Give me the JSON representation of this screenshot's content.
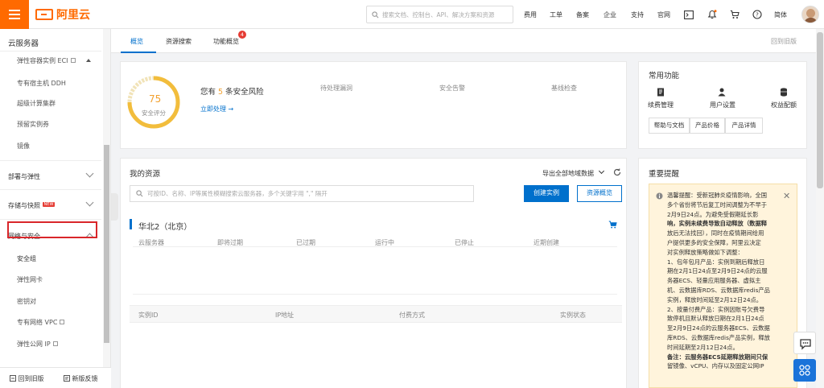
{
  "brand": {
    "logo_text": "阿里云",
    "accent": "#ff6a00",
    "primary": "#0070cc"
  },
  "topbar": {
    "search_placeholder": "搜索文档、控制台、API、解决方案和资源",
    "links": [
      "费用",
      "工单",
      "备案",
      "企业",
      "支持",
      "官网"
    ],
    "language": "简体",
    "icons": [
      "terminal-icon",
      "bell-icon",
      "cart-icon",
      "help-icon"
    ]
  },
  "sidebar": {
    "title": "云服务器",
    "top_items": [
      "弹性容器实例 ECI",
      "专有宿主机 DDH",
      "超级计算集群",
      "预留实例券",
      "镜像"
    ],
    "groups": {
      "deploy": "部署与弹性",
      "storage": "存储与快照",
      "storage_badge": "NEW",
      "network": "网络与安全"
    },
    "network_items": [
      "安全组",
      "弹性网卡",
      "密钥对",
      "专有网络 VPC",
      "弹性公网 IP"
    ],
    "footer_back": "回到旧版",
    "footer_feedback": "新版反馈"
  },
  "tabs": {
    "items": [
      "概览",
      "资源搜索",
      "功能概览"
    ],
    "badge": "4",
    "back_old": "回到旧版"
  },
  "security": {
    "score": "75",
    "score_label": "安全评分",
    "risk_prefix": "您有",
    "risk_count": "5",
    "risk_suffix": "条安全风险",
    "action": "立即处理",
    "cols": [
      "待处理漏洞",
      "安全告警",
      "基线检查"
    ]
  },
  "common": {
    "title": "常用功能",
    "items": [
      "续费管理",
      "用户设置",
      "权益配额"
    ],
    "chips": [
      "帮助与文档",
      "产品价格",
      "产品详情"
    ]
  },
  "resources": {
    "title": "我的资源",
    "export": "导出全部地域数据",
    "search_placeholder": "可按ID、名称、IP等属性模糊搜索云服务器，多个关键字用 \",\" 隔开",
    "create": "创建实例",
    "overview": "资源概览",
    "region": "华北2（北京）",
    "stats": [
      "云服务器",
      "即将过期",
      "已过期",
      "运行中",
      "已停止",
      "近期创建"
    ],
    "columns": [
      "实例ID",
      "IP地址",
      "付费方式",
      "实例状态"
    ]
  },
  "notice": {
    "title": "重要提醒",
    "lines": [
      "温馨提醒：受新冠肺炎疫情影响，全国",
      "多个省份将节后复工时间调整为不早于",
      "2月9日24点。为避免受假期延长影",
      "响，实例未续费导致自动释放（数据释",
      "放后无法找回），同时在疫情期间给用",
      "户提供更多的安全保障，阿里云决定",
      "对实例释放策略做如下调整：",
      "1、包年包月产品：实例到期后释放日",
      "期在2月1日24点至2月9日24点的云服",
      "务器ECS、轻量应用服务器、虚拟主",
      "机、云数据库RDS、云数据库redis产品",
      "实例，释放时间延至2月12日24点。",
      "2、按量付费产品：实例因账号欠费导",
      "致停机且默认释放日期在2月1日24点",
      "至2月9日24点的云服务器ECS、云数据",
      "库RDS、云数据库redis产品实例，释放",
      "时间延期至2月12日24点。",
      "备注：云服务器ECS延期释放期间只保",
      "留镜像、vCPU、内存以及固定公网IP"
    ]
  }
}
